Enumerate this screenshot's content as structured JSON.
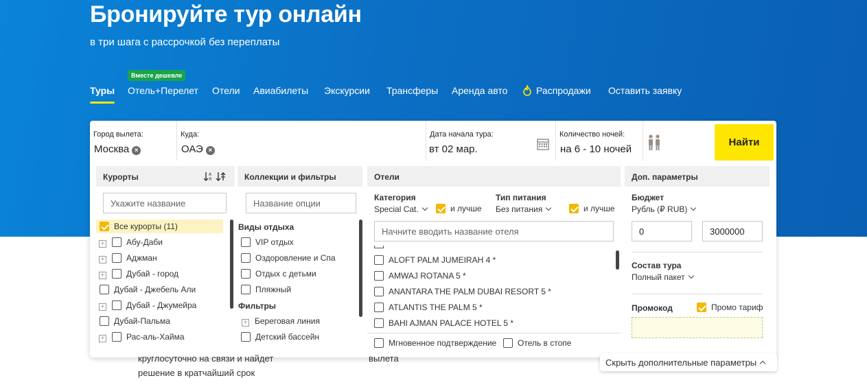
{
  "hero": {
    "title": "Бронируйте тур онлайн",
    "subtitle": "в три шага с рассрочкой без переплаты"
  },
  "nav": {
    "badge": "Вместе дешевле",
    "items": [
      "Туры",
      "Отель+Перелет",
      "Отели",
      "Авиабилеты",
      "Экскурсии",
      "Трансферы",
      "Аренда авто",
      "Распродажи",
      "Оставить заявку"
    ],
    "active": "Туры",
    "sale_icon": "fire-icon"
  },
  "search": {
    "from_label": "Город вылета:",
    "from_value": "Москва",
    "to_label": "Куда:",
    "to_value": "ОАЭ",
    "date_label": "Дата начала тура:",
    "date_value": "вт 02 мар.",
    "nights_label": "Количество ночей:",
    "nights_value": "на 6 - 10 ночей",
    "find_label": "Найти",
    "clear_glyph": "×"
  },
  "resorts": {
    "header": "Курорты",
    "placeholder": "Укажите название",
    "items": [
      {
        "label": "Все курорты (11)",
        "checked": true,
        "expandable": false
      },
      {
        "label": "Абу-Даби",
        "checked": false,
        "expandable": true
      },
      {
        "label": "Аджман",
        "checked": false,
        "expandable": true
      },
      {
        "label": "Дубай - город",
        "checked": false,
        "expandable": true
      },
      {
        "label": "Дубай - Джебель Али",
        "checked": false,
        "expandable": false
      },
      {
        "label": "Дубай - Джумейра",
        "checked": false,
        "expandable": true
      },
      {
        "label": "Дубай-Пальма",
        "checked": false,
        "expandable": false
      },
      {
        "label": "Рас-аль-Хайма",
        "checked": false,
        "expandable": true
      }
    ]
  },
  "collections": {
    "header": "Коллекции и фильтры",
    "placeholder": "Название опции",
    "group1": "Виды отдыха",
    "group1_items": [
      "VIP отдых",
      "Оздоровление и Спа",
      "Отдых с детьми",
      "Пляжный"
    ],
    "group2": "Фильтры",
    "group2_items": [
      {
        "label": "Береговая линия",
        "expandable": true
      },
      {
        "label": "Детский бассейн",
        "expandable": false
      }
    ]
  },
  "hotels": {
    "header": "Отели",
    "category_label": "Категория",
    "category_value": "Special Cat.",
    "and_better": "и лучше",
    "meal_label": "Тип питания",
    "meal_value": "Без питания",
    "placeholder": "Начните вводить название отеля",
    "items": [
      "ALOFT PALM JUMEIRAH 4 *",
      "AMWAJ ROTANA 5 *",
      "ANANTARA THE PALM DUBAI RESORT 5 *",
      "ATLANTIS THE PALM 5 *",
      "BAHI AJMAN PALACE HOTEL 5 *"
    ],
    "instant_label": "Мгновенное подтверждение",
    "stop_label": "Отель в стопе"
  },
  "extra": {
    "header": "Доп. параметры",
    "budget_label": "Бюджет",
    "budget_currency": "Рубль (₽ RUB)",
    "budget_min": "0",
    "budget_max": "3000000",
    "composition_label": "Состав тура",
    "composition_value": "Полный пакет",
    "promo_label": "Промокод",
    "promo_tariff": "Промо тариф"
  },
  "below": {
    "text1_line1": "круглосуточно на связи и найдет",
    "text1_line2": "решение в кратчайший срок",
    "text2": "вылета"
  },
  "hide_label": "Скрыть дополнительные параметры",
  "colors": {
    "hero": "#0b6fc4",
    "accent": "#ffe600",
    "checkbox": "#f3b800",
    "badge": "#1aa34a"
  }
}
